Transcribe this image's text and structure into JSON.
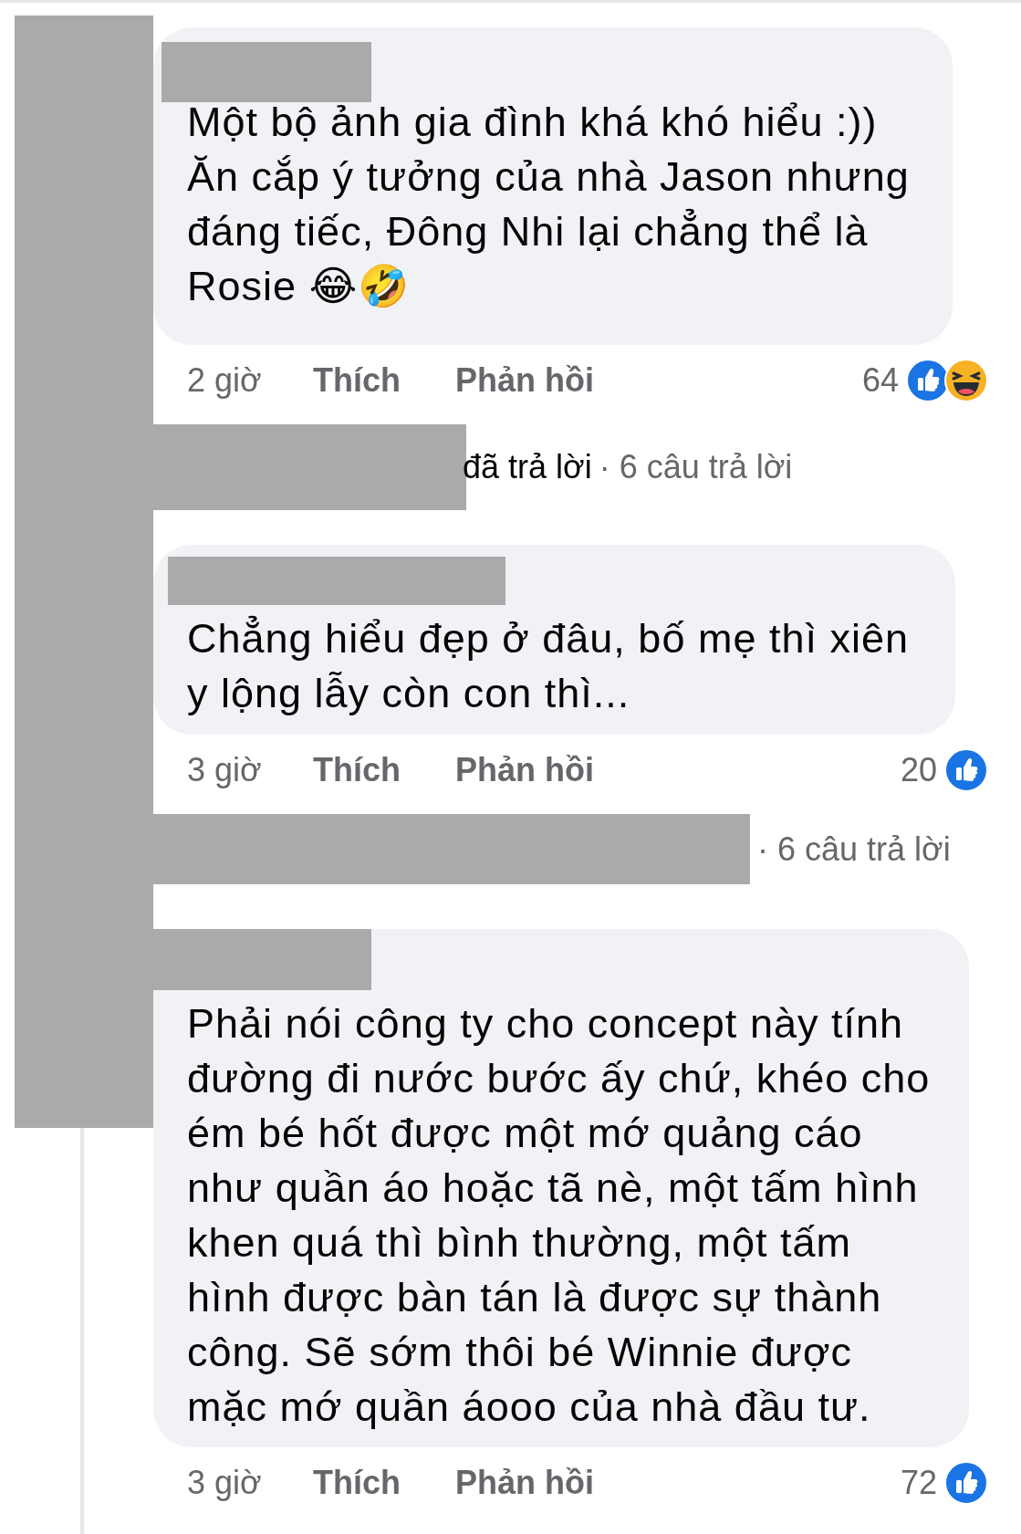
{
  "comments": [
    {
      "text": "Một bộ ảnh gia đình khá khó hiểu :))\nĂn cắp ý tưởng của nhà Jason nhưng\nđáng tiếc, Đông Nhi lại chẳng thể là\nRosie 😂🤣",
      "time": "2 giờ",
      "like_label": "Thích",
      "reply_label": "Phản hồi",
      "reaction_count": "64",
      "reactions": [
        {
          "kind": "like"
        },
        {
          "kind": "haha"
        }
      ],
      "replies": {
        "replied_text": "đã trả lời",
        "count_text": "· 6 câu trả lời"
      }
    },
    {
      "text": "Chẳng hiểu đẹp ở đâu, bố mẹ thì xiên\ny lộng lẫy còn con thì...",
      "time": "3 giờ",
      "like_label": "Thích",
      "reply_label": "Phản hồi",
      "reaction_count": "20",
      "reactions": [
        {
          "kind": "like"
        }
      ],
      "replies": {
        "count_text": "· 6 câu trả lời"
      }
    },
    {
      "text": "Phải nói công ty cho concept này tính\nđường đi nước bước ấy chứ, khéo cho\ném bé hốt được một mớ quảng cáo\nnhư quần áo hoặc tã nè, một tấm hình\nkhen quá thì bình thường, một tấm\nhình được bàn tán là được sự thành\ncông. Sẽ sớm thôi bé Winnie được\nmặc mớ quần áooo của nhà đầu tư.",
      "time": "3 giờ",
      "like_label": "Thích",
      "reply_label": "Phản hồi",
      "reaction_count": "72",
      "reactions": [
        {
          "kind": "like"
        }
      ]
    }
  ]
}
